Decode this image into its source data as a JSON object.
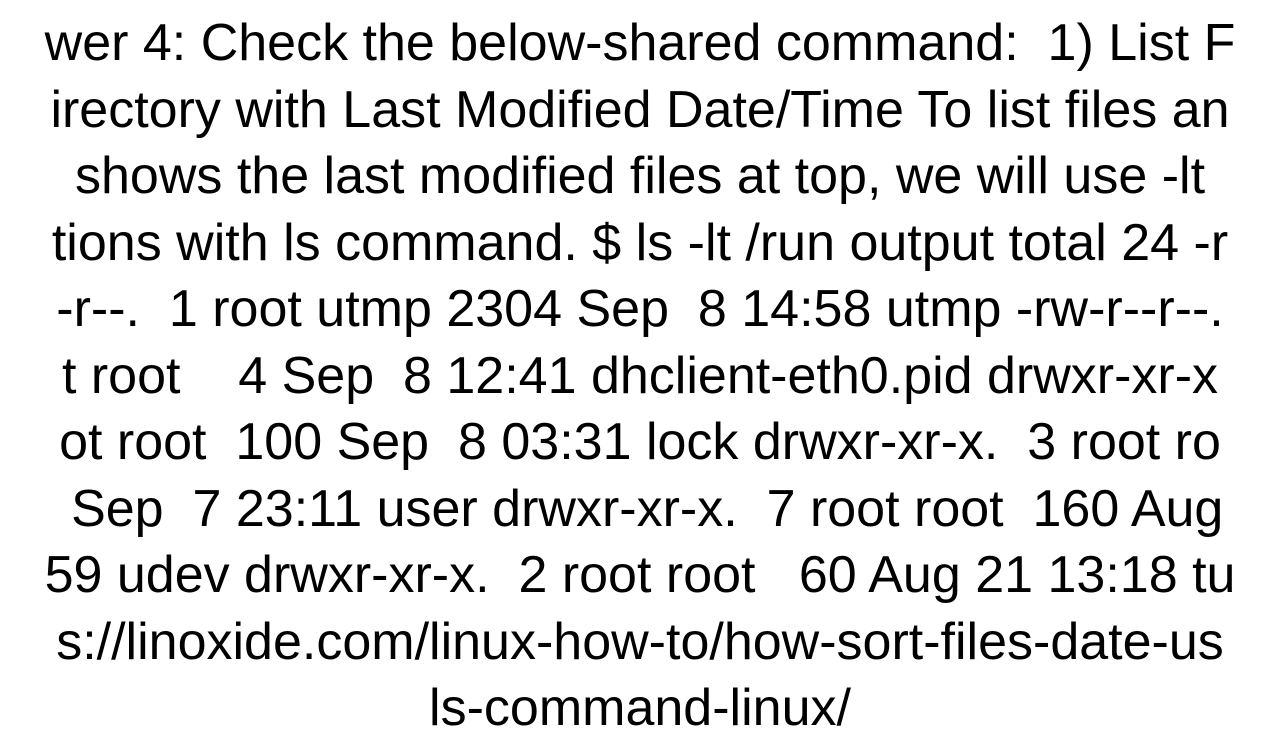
{
  "document": {
    "body_text": "wer 4: Check the below-shared command:  1) List F\nirectory with Last Modified Date/Time To list files an\n shows the last modified files at top, we will use -lt \ntions with ls command. $ ls -lt /run output total 24 -r\n-r--.  1 root utmp 2304 Sep  8 14:58 utmp -rw-r--r--.\nt root    4 Sep  8 12:41 dhclient-eth0.pid drwxr-xr-x\not root  100 Sep  8 03:31 lock drwxr-xr-x.  3 root ro\n Sep  7 23:11 user drwxr-xr-x.  7 root root  160 Aug\n59 udev drwxr-xr-x.  2 root root   60 Aug 21 13:18 tu\ns://linoxide.com/linux-how-to/how-sort-files-date-us\nls-command-linux/"
  }
}
